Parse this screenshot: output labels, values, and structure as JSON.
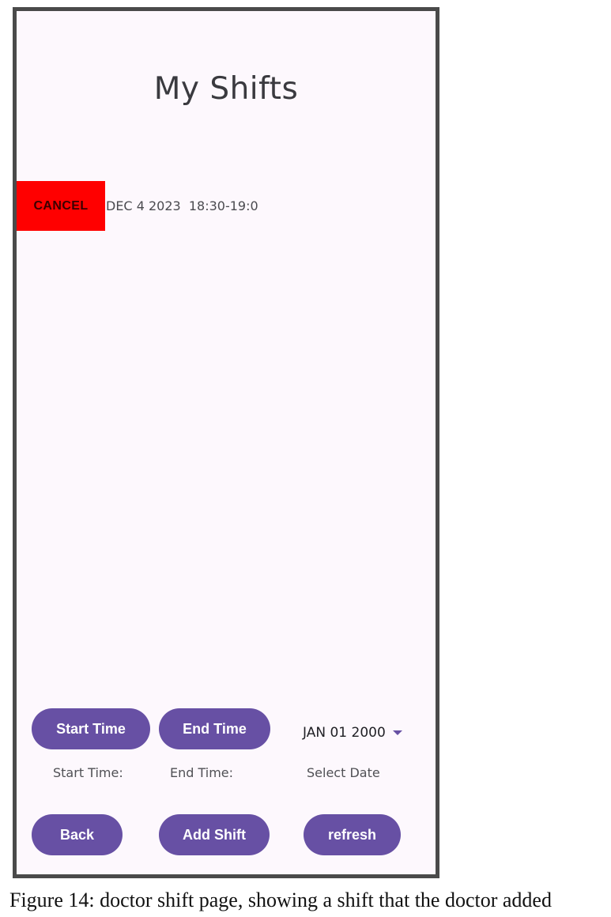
{
  "header": {
    "title": "My Shifts"
  },
  "shifts": [
    {
      "cancel_label": "CANCEL",
      "text": "DEC 4 2023  18:30-19:0"
    }
  ],
  "controls": {
    "start_time_button": "Start Time",
    "end_time_button": "End Time",
    "date_select_value": "JAN 01 2000",
    "start_time_label": "Start Time:",
    "end_time_label": "End Time:",
    "select_date_label": "Select Date",
    "back_button": "Back",
    "add_shift_button": "Add Shift",
    "refresh_button": "refresh"
  },
  "caption": "Figure 14: doctor shift page, showing a shift that the doctor added",
  "colors": {
    "accent": "#6750a4",
    "cancel_bg": "#ff0000",
    "screen_bg": "#fdf8fd"
  },
  "icons": {
    "date_dropdown": "dropdown-arrow-icon"
  }
}
